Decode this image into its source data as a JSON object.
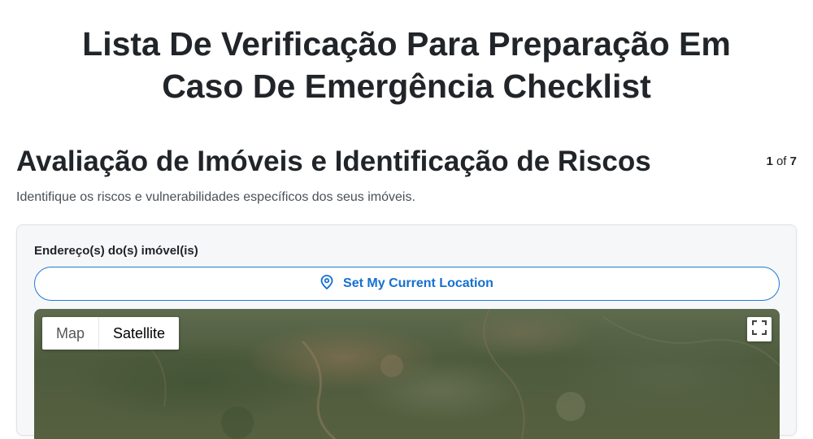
{
  "page": {
    "title_line1": "Lista De Verificação Para Preparação Em",
    "title_line2": "Caso De Emergência Checklist"
  },
  "section": {
    "title": "Avaliação de Imóveis e Identificação de Riscos",
    "step_current": "1",
    "step_of": "of",
    "step_total": "7",
    "description": "Identifique os riscos e vulnerabilidades específicos dos seus imóveis."
  },
  "form": {
    "address_label": "Endereço(s) do(s) imóvel(is)",
    "location_button": "Set My Current Location",
    "location_icon": "map-pin-icon"
  },
  "map": {
    "type_options": [
      "Map",
      "Satellite"
    ],
    "selected_type": "Satellite",
    "fullscreen_icon": "fullscreen-icon"
  },
  "colors": {
    "accent": "#1470d0",
    "card_bg": "#f6f7f9"
  }
}
